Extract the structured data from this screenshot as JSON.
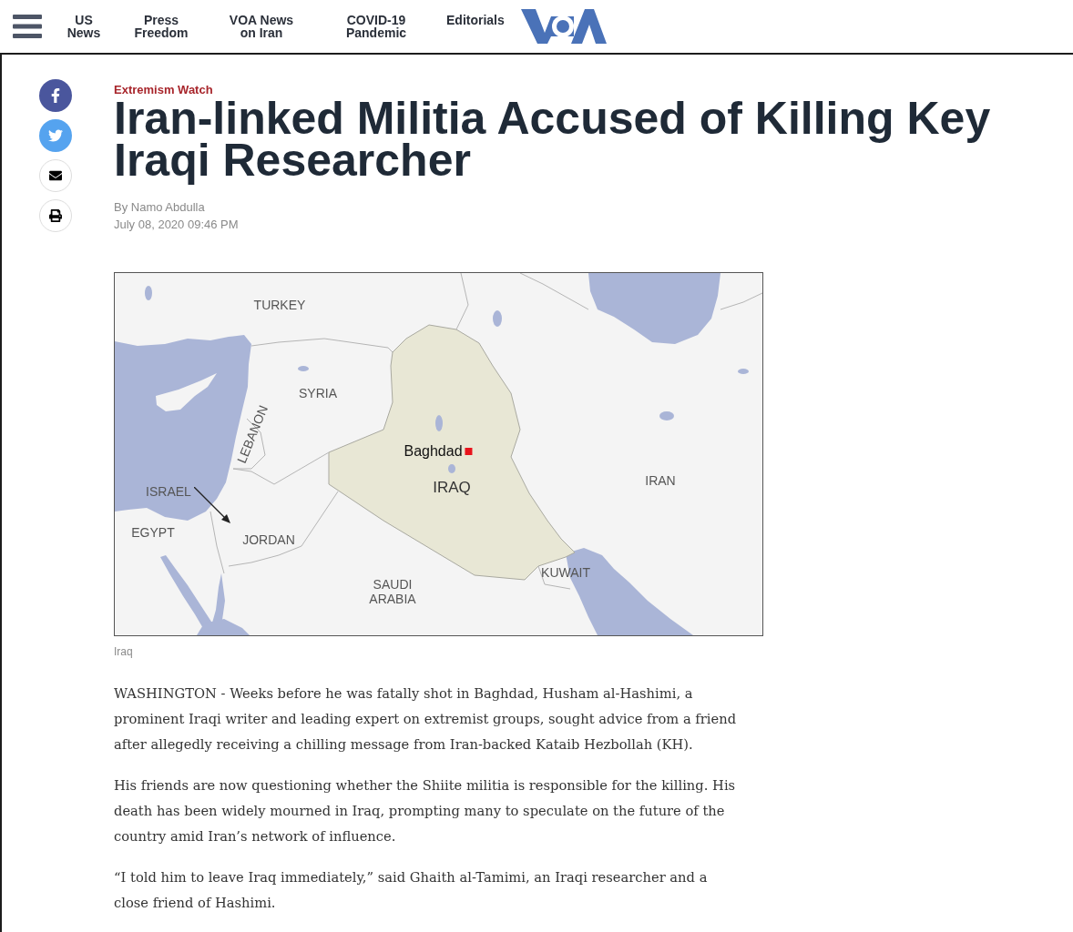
{
  "header": {
    "nav": [
      {
        "label": "US News"
      },
      {
        "label": "Press Freedom"
      },
      {
        "label": "VOA News on Iran"
      },
      {
        "label": "COVID-19 Pandemic"
      },
      {
        "label": "Editorials"
      }
    ]
  },
  "article": {
    "category": "Extremism Watch",
    "title": "Iran-linked Militia Accused of Killing Key Iraqi Researcher",
    "byline": "By Namo Abdulla",
    "date": "July 08, 2020 09:46 PM",
    "map": {
      "labels": [
        {
          "text": "TURKEY",
          "kind": "country"
        },
        {
          "text": "SYRIA",
          "kind": "country"
        },
        {
          "text": "LEBANON",
          "kind": "country"
        },
        {
          "text": "ISRAEL",
          "kind": "country"
        },
        {
          "text": "EGYPT",
          "kind": "country"
        },
        {
          "text": "JORDAN",
          "kind": "country"
        },
        {
          "text": "SAUDI ARABIA",
          "kind": "country"
        },
        {
          "text": "Baghdad",
          "kind": "city"
        },
        {
          "text": "IRAQ",
          "kind": "focus"
        },
        {
          "text": "IRAN",
          "kind": "country"
        },
        {
          "text": "KUWAIT",
          "kind": "country"
        }
      ]
    },
    "caption": "Iraq",
    "paragraphs": [
      "WASHINGTON - Weeks before he was fatally shot in Baghdad, Husham al-Hashimi, a prominent Iraqi writer and leading expert on extremist groups, sought advice from a friend after allegedly receiving a chilling message from Iran-backed Kataib Hezbollah (KH).",
      "His friends are now questioning whether the Shiite militia is responsible for the killing. His death has been widely mourned in Iraq, prompting many to speculate on the future of the country amid Iran’s network of influence.",
      "“I told him to leave Iraq immediately,” said Ghaith al-Tamimi, an Iraqi researcher and a close friend of Hashimi."
    ]
  }
}
